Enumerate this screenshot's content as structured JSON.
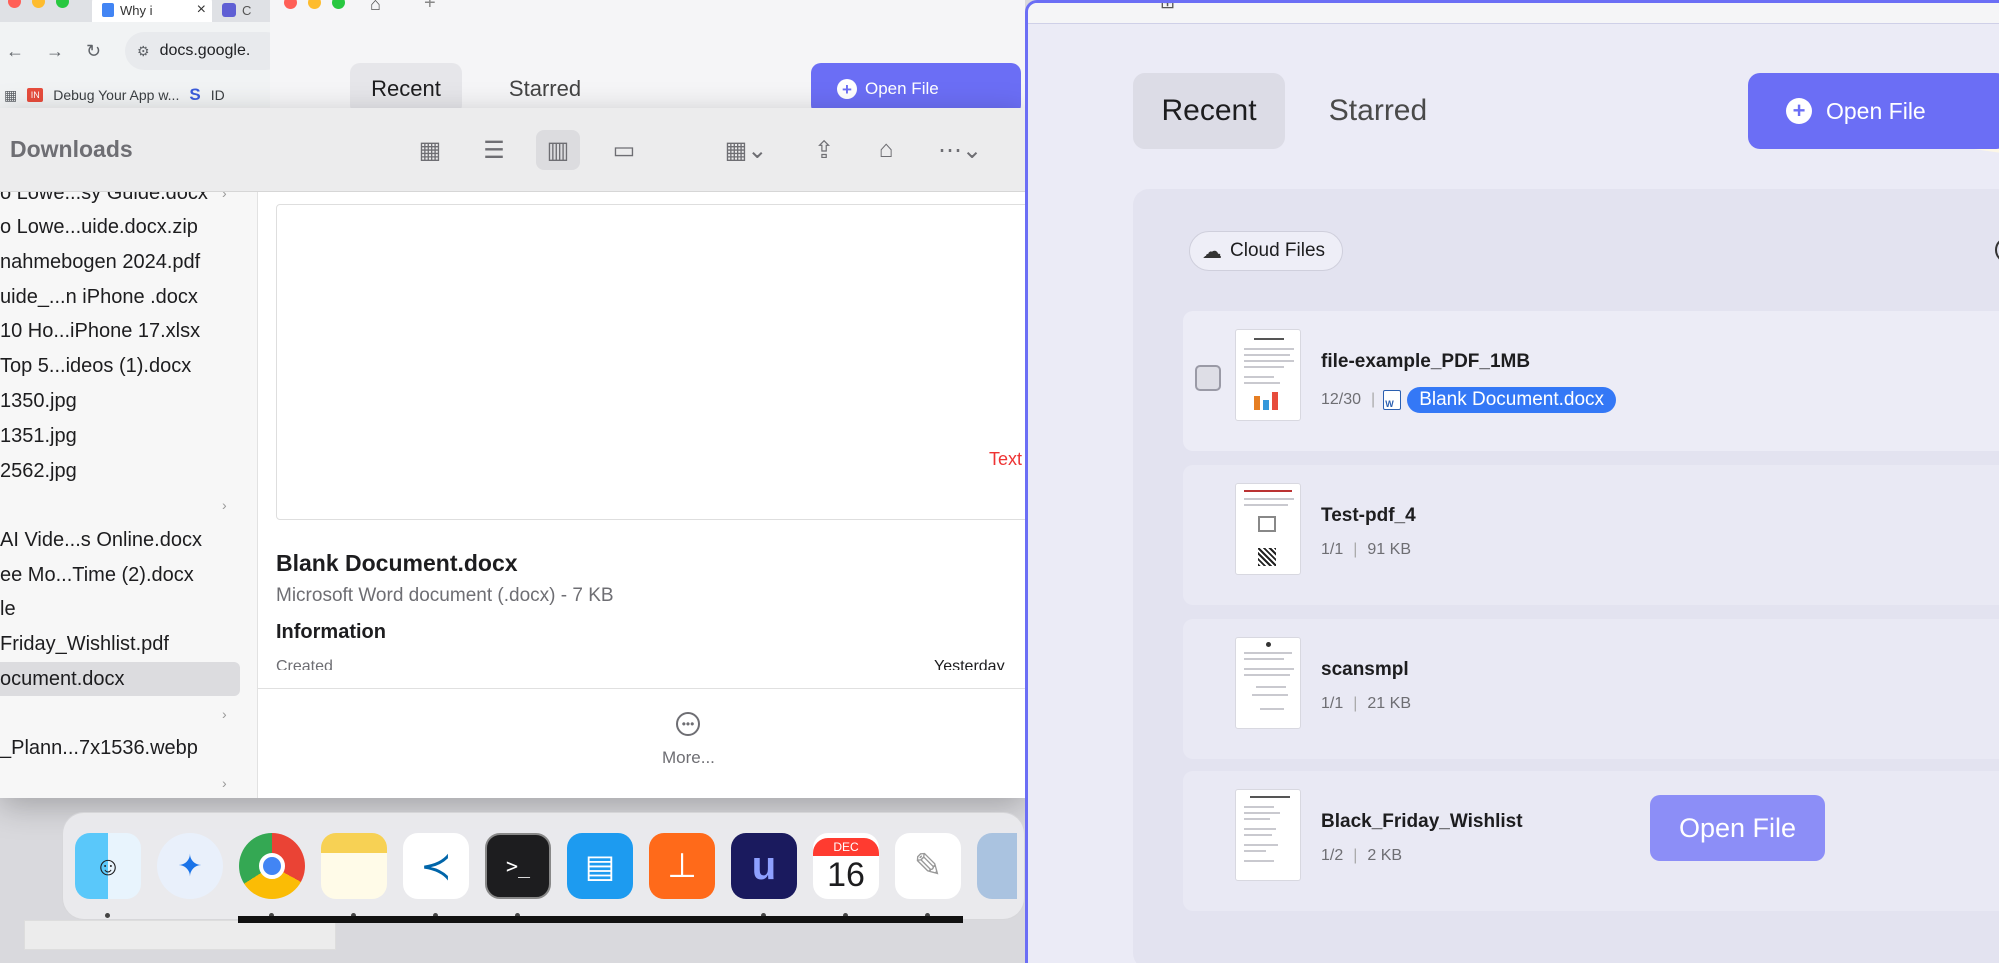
{
  "browser": {
    "tab_title": "Why i",
    "tab2_title": "C",
    "url": "docs.google.",
    "bookmark": "Debug Your App w...",
    "bookmark2": "ID"
  },
  "small_window": {
    "recent": "Recent",
    "starred": "Starred",
    "open_file": "Open File"
  },
  "finder": {
    "title": "Downloads",
    "files": [
      {
        "name": "o Lowe...sy Guide.docx",
        "chevron": true
      },
      {
        "name": "o Lowe...uide.docx.zip"
      },
      {
        "name": "nahmebogen 2024.pdf"
      },
      {
        "name": "uide_...n iPhone .docx"
      },
      {
        "name": "10 Ho...iPhone 17.xlsx"
      },
      {
        "name": " Top 5...ideos  (1).docx"
      },
      {
        "name": "1350.jpg"
      },
      {
        "name": "1351.jpg"
      },
      {
        "name": "2562.jpg"
      },
      {
        "name": "",
        "chevron": true
      },
      {
        "name": "AI Vide...s Online.docx"
      },
      {
        "name": "ee Mo...Time  (2).docx"
      },
      {
        "name": "le"
      },
      {
        "name": "Friday_Wishlist.pdf"
      },
      {
        "name": "ocument.docx",
        "selected": true
      },
      {
        "name": "",
        "chevron": true
      },
      {
        "name": "_Plann...7x1536.webp"
      },
      {
        "name": "",
        "chevron": true
      }
    ],
    "preview": {
      "text_label": "Text",
      "name": "Blank Document.docx",
      "kind": "Microsoft Word document (.docx) - 7 KB",
      "info_heading": "Information",
      "created_label": "Created",
      "created_value": "Yesterday",
      "more": "More..."
    }
  },
  "dock": {
    "calendar_month": "DEC",
    "calendar_day": "16",
    "terminal": ">_"
  },
  "main": {
    "recent": "Recent",
    "starred": "Starred",
    "open_file": "Open File",
    "cloud_files": "Cloud Files",
    "files": [
      {
        "name": "file-example_PDF_1MB",
        "pages": "12/30",
        "drag": "Blank Document.docx"
      },
      {
        "name": "Test-pdf_4",
        "pages": "1/1",
        "size": "91 KB"
      },
      {
        "name": "scansmpl",
        "pages": "1/1",
        "size": "21 KB"
      },
      {
        "name": "Black_Friday_Wishlist",
        "pages": "1/2",
        "size": "2 KB"
      }
    ],
    "row_open_button": "Open File"
  },
  "colors": {
    "accent": "#6b6ef5",
    "selection_blue": "#3478f6",
    "preview_text_red": "#e33333"
  }
}
